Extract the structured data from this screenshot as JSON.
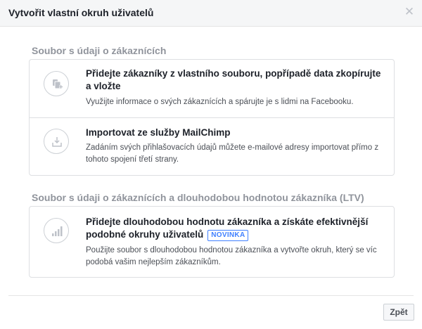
{
  "dialog": {
    "title": "Vytvořit vlastní okruh uživatelů",
    "close_icon": "close-icon"
  },
  "sections": [
    {
      "label": "Soubor s údaji o zákaznících",
      "options": [
        {
          "title": "Přidejte zákazníky z vlastního souboru, popřípadě data zkopírujte a vložte",
          "description": "Využijte informace o svých zákaznících a spárujte je s lidmi na Facebooku.",
          "icon": "file-add-icon"
        },
        {
          "title": "Importovat ze služby MailChimp",
          "description": "Zadáním svých přihlašovacích údajů můžete e-mailové adresy importovat přímo z tohoto spojení třetí strany.",
          "icon": "import-icon"
        }
      ]
    },
    {
      "label": "Soubor s údaji o zákaznících a dlouhodobou hodnotou zákazníka (LTV)",
      "options": [
        {
          "title": "Přidejte dlouhodobou hodnotu zákazníka a získáte efektivnější podobné okruhy uživatelů",
          "badge": "NOVINKA",
          "description": "Použijte soubor s dlouhodobou hodnotou zákazníka a vytvořte okruh, který se víc podobá vašim nejlepším zákazníkům.",
          "icon": "bar-chart-icon"
        }
      ]
    }
  ],
  "footer": {
    "back_label": "Zpět"
  },
  "colors": {
    "header_bg": "#f5f6f7",
    "border": "#dddfe2",
    "muted_text": "#90949c",
    "badge_blue": "#4080ff",
    "icon_gray": "#bec2c9"
  }
}
